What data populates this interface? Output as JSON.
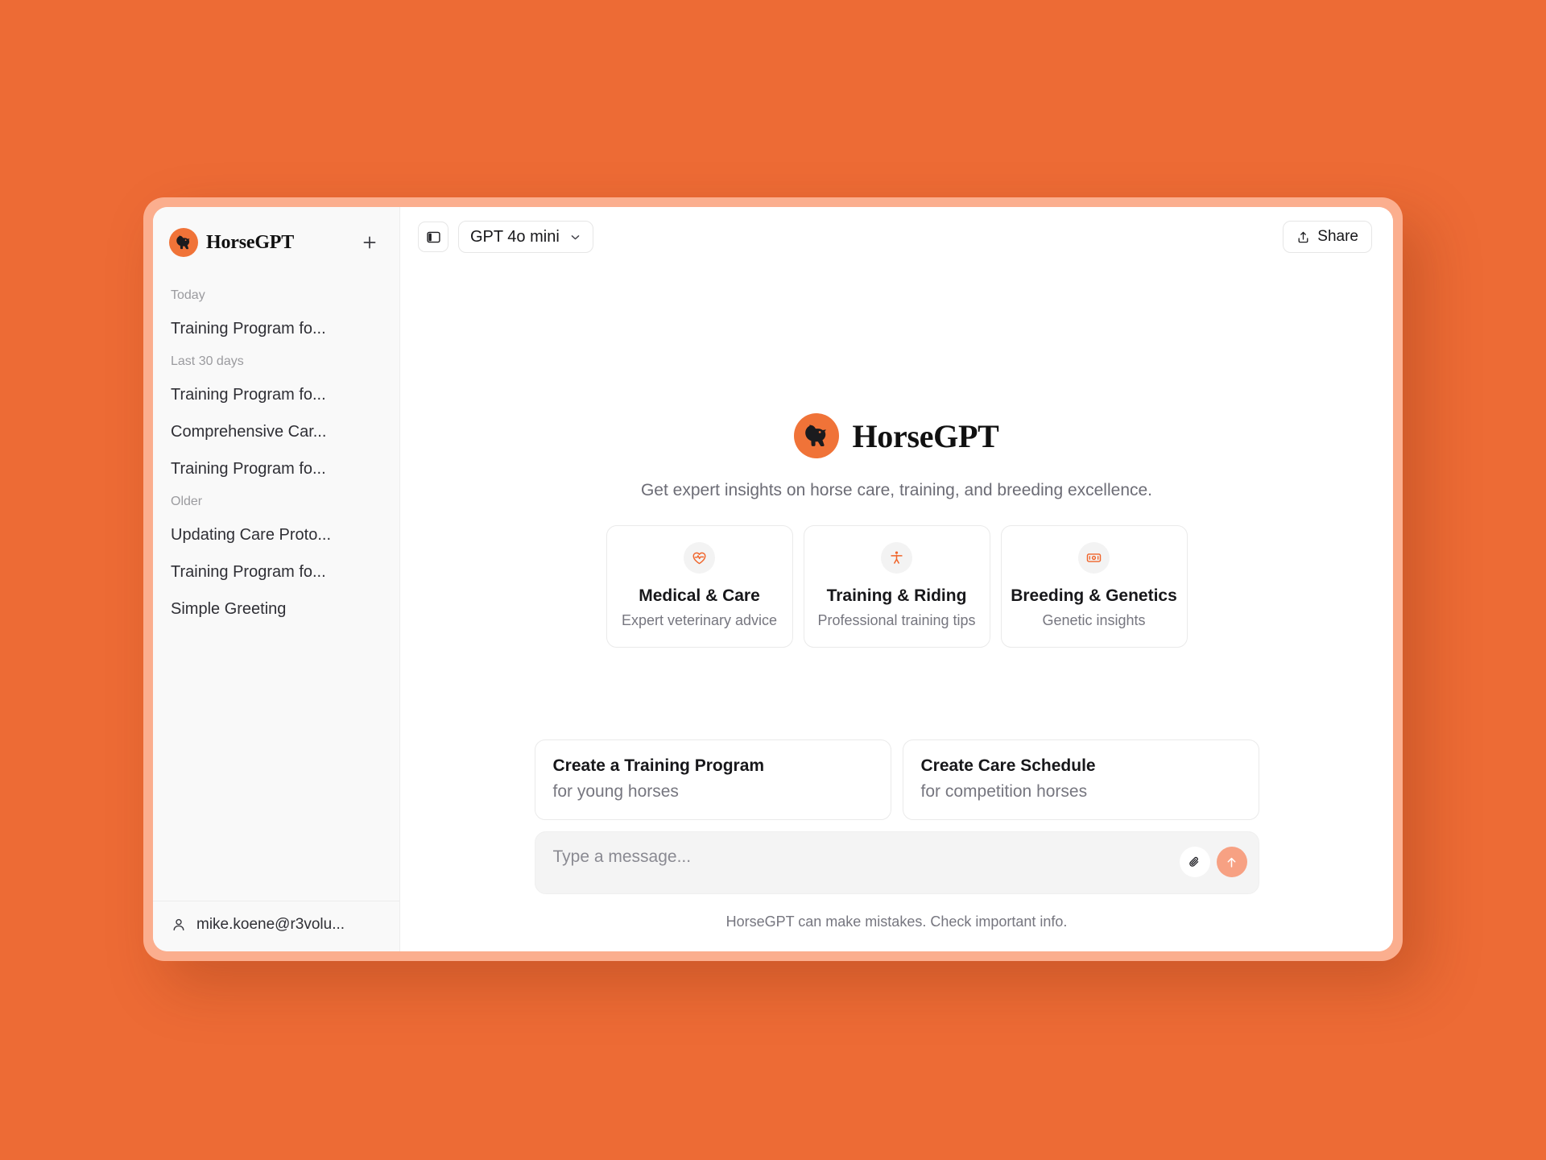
{
  "theme": {
    "background": "#ED6B35",
    "frame": "#FBAE8E",
    "accent": "#F07338",
    "send_button": "#F7A183"
  },
  "sidebar": {
    "brand_name": "HorseGPT",
    "brand_logo_icon": "horse-head-logo-icon",
    "new_chat_icon": "plus-icon",
    "groups": [
      {
        "label": "Today",
        "items": [
          {
            "title": "Training Program fo..."
          }
        ]
      },
      {
        "label": "Last 30 days",
        "items": [
          {
            "title": "Training Program fo..."
          },
          {
            "title": "Comprehensive Car..."
          },
          {
            "title": "Training Program fo..."
          }
        ]
      },
      {
        "label": "Older",
        "items": [
          {
            "title": "Updating Care Proto..."
          },
          {
            "title": "Training Program fo..."
          },
          {
            "title": "Simple Greeting"
          }
        ]
      }
    ],
    "account": {
      "icon": "user-icon",
      "label": "mike.koene@r3volu..."
    }
  },
  "topbar": {
    "sidebar_toggle_icon": "sidebar-panel-icon",
    "model": {
      "label": "GPT 4o mini",
      "chevron_icon": "chevron-down-icon"
    },
    "share": {
      "label": "Share",
      "icon": "share-upload-icon"
    }
  },
  "hero": {
    "logo_icon": "horse-head-logo-icon",
    "title": "HorseGPT",
    "tagline": "Get expert insights on horse care, training, and breeding excellence.",
    "cards": [
      {
        "icon": "heart-pulse-icon",
        "title": "Medical & Care",
        "subtitle": "Expert veterinary advice"
      },
      {
        "icon": "person-figure-icon",
        "title": "Training & Riding",
        "subtitle": "Professional training tips"
      },
      {
        "icon": "banknote-icon",
        "title": "Breeding & Genetics",
        "subtitle": "Genetic insights"
      }
    ]
  },
  "composer": {
    "suggestions": [
      {
        "title": "Create a Training Program",
        "subtitle": "for young horses"
      },
      {
        "title": "Create Care Schedule",
        "subtitle": "for competition horses"
      }
    ],
    "input_placeholder": "Type a message...",
    "input_value": "",
    "attach_icon": "paperclip-icon",
    "send_icon": "arrow-up-icon"
  },
  "footnote": "HorseGPT can make mistakes. Check important info."
}
